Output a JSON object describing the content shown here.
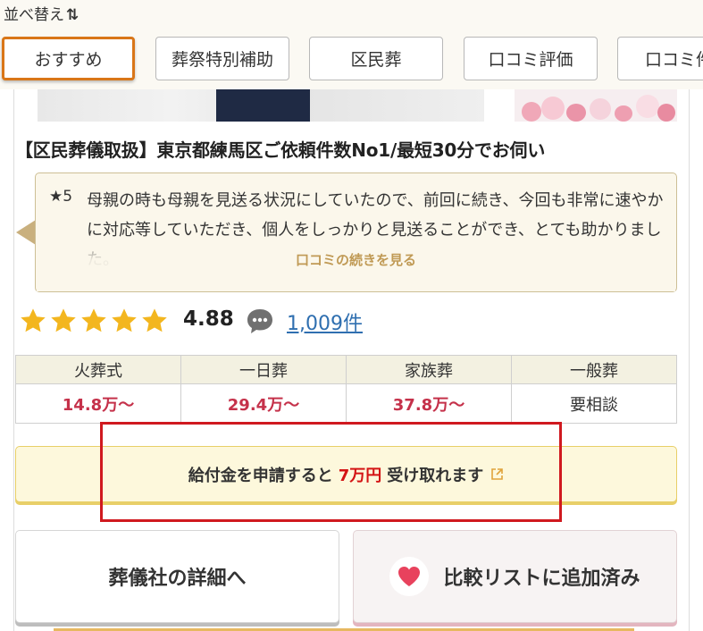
{
  "sort": {
    "label": "並べ替え",
    "icon": "sort-arrows-icon",
    "arrows": "⇅",
    "chips": [
      {
        "label": "おすすめ",
        "active": true
      },
      {
        "label": "葬祭特別補助",
        "active": false
      },
      {
        "label": "区民葬",
        "active": false
      },
      {
        "label": "口コミ評価",
        "active": false
      },
      {
        "label": "口コミ件",
        "active": false
      }
    ]
  },
  "listing": {
    "title": "【区民葬儀取扱】東京都練馬区ご依頼件数No1/最短30分でお伺い",
    "review": {
      "score": "★5",
      "text": "母親の時も母親を見送る状況にしていたので、前回に続き、今回も非常に速やかに対応等していただき、個人をしっかりと見送ることができ、とても助かりました。",
      "more_label": "口コミの続きを見る"
    },
    "rating": {
      "value": "4.88",
      "stars": 5,
      "review_count": "1,009件"
    },
    "prices": {
      "headers": [
        "火葬式",
        "一日葬",
        "家族葬",
        "一般葬"
      ],
      "values": [
        "14.8万～",
        "29.4万～",
        "37.8万～",
        "要相談"
      ]
    },
    "benefit": {
      "prefix": "給付金を申請すると",
      "amount": "7万円",
      "suffix": "受け取れます"
    },
    "buttons": {
      "detail": "葬儀社の詳細へ",
      "compare": "比較リストに追加済み"
    }
  },
  "colors": {
    "accent": "#d97618",
    "price": "#c5314a",
    "amount": "#d41414",
    "link": "#2f6fb0",
    "star": "#f3b61f",
    "highlight": "#d0191f",
    "heart": "#e8425d"
  }
}
